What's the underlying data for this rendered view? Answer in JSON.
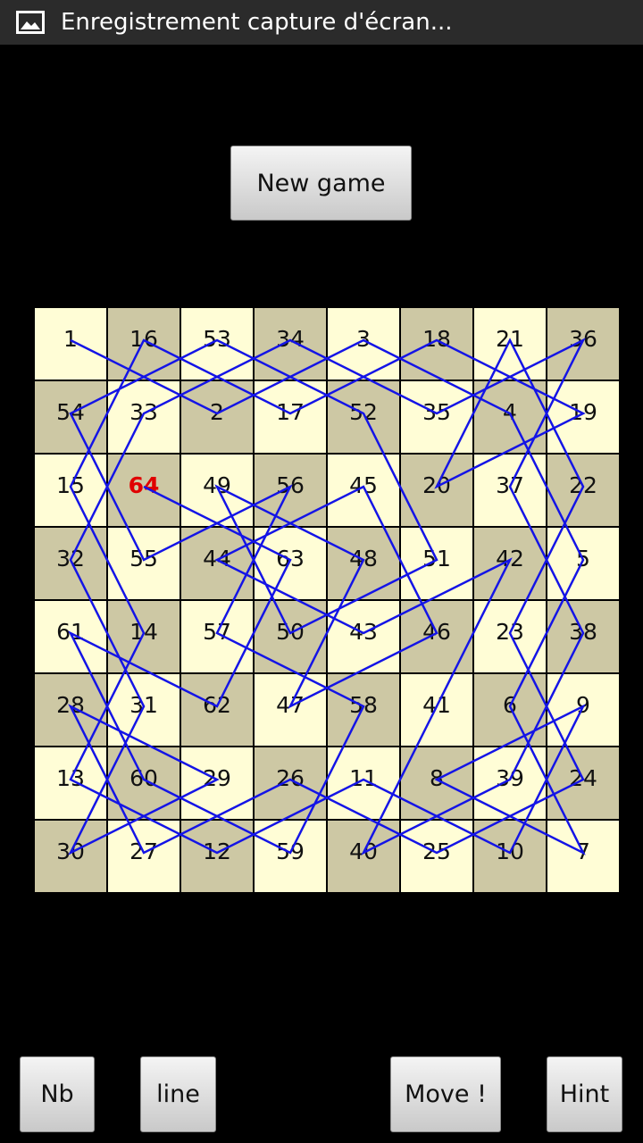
{
  "status_bar": {
    "icon": "image-icon",
    "title": "Enregistrement capture d'écran..."
  },
  "new_game_label": "New game",
  "board": {
    "size": 8,
    "current_move": 64,
    "path_color": "#1414e6",
    "current_color": "#e00000",
    "light_color": "#fffdd6",
    "dark_color": "#cdc8a4",
    "rows": [
      [
        "1",
        "16",
        "53",
        "34",
        "3",
        "18",
        "21",
        "36"
      ],
      [
        "54",
        "33",
        "2",
        "17",
        "52",
        "35",
        "4",
        "19"
      ],
      [
        "15",
        "64",
        "49",
        "56",
        "45",
        "20",
        "37",
        "22"
      ],
      [
        "32",
        "55",
        "44",
        "63",
        "48",
        "51",
        "42",
        "5"
      ],
      [
        "61",
        "14",
        "57",
        "50",
        "43",
        "46",
        "23",
        "38"
      ],
      [
        "28",
        "31",
        "62",
        "47",
        "58",
        "41",
        "6",
        "9"
      ],
      [
        "13",
        "60",
        "29",
        "26",
        "11",
        "8",
        "39",
        "24"
      ],
      [
        "30",
        "27",
        "12",
        "59",
        "40",
        "25",
        "10",
        "7"
      ]
    ]
  },
  "bottom_buttons": {
    "nb": "Nb",
    "line": "line",
    "move": "Move !",
    "hint": "Hint"
  }
}
